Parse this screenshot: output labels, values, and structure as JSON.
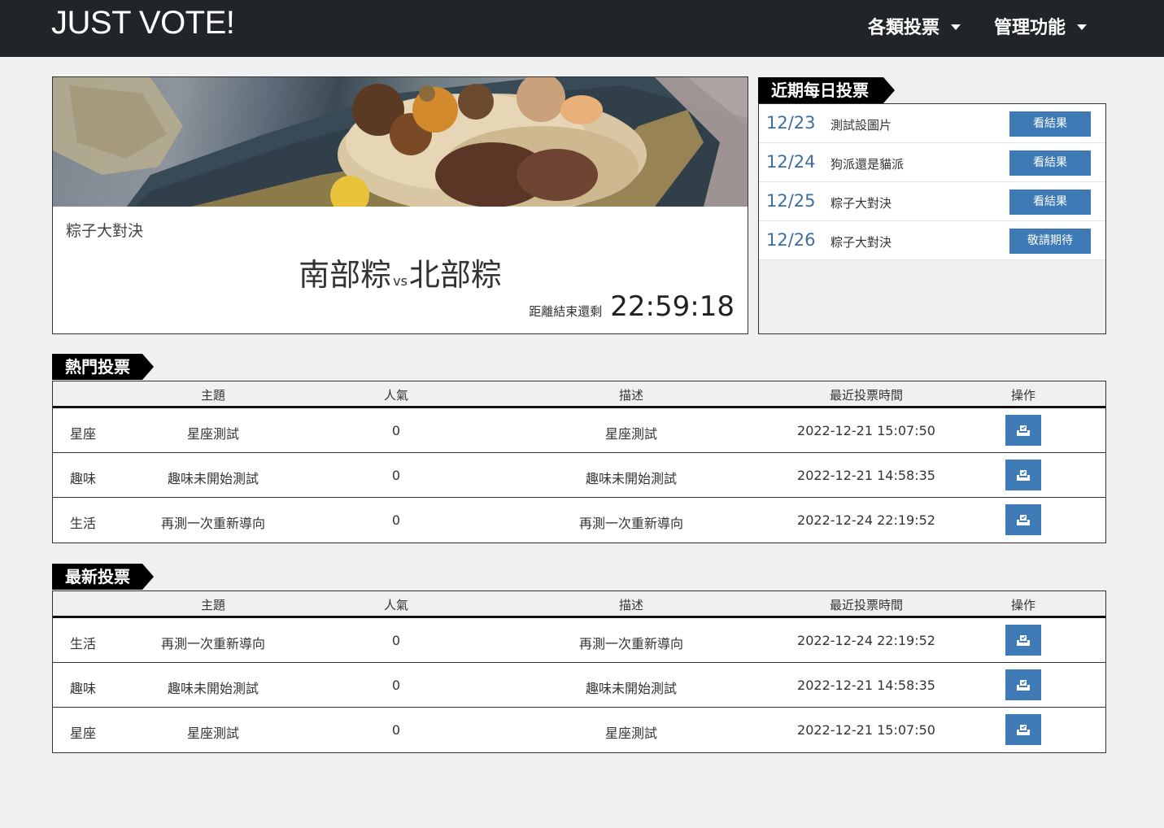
{
  "navbar": {
    "brand": "JUST VOTE!",
    "menus": [
      {
        "label": "各類投票"
      },
      {
        "label": "管理功能"
      }
    ]
  },
  "feature": {
    "title": "粽子大對決",
    "option_a": "南部粽",
    "vs": "vs",
    "option_b": "北部粽",
    "countdown_label": "距離結束還剩",
    "countdown_time": "22:59:18"
  },
  "daily": {
    "heading": "近期每日投票",
    "items": [
      {
        "date": "12/23",
        "topic": "測試設圖片",
        "button": "看結果"
      },
      {
        "date": "12/24",
        "topic": "狗派還是貓派",
        "button": "看結果"
      },
      {
        "date": "12/25",
        "topic": "粽子大對決",
        "button": "看結果"
      },
      {
        "date": "12/26",
        "topic": "粽子大對決",
        "button": "敬請期待"
      }
    ]
  },
  "table_headers": [
    "主題",
    "人氣",
    "描述",
    "最近投票時間",
    "操作"
  ],
  "hot": {
    "heading": "熱門投票",
    "rows": [
      {
        "category": "星座",
        "topic": "星座測試",
        "popularity": "0",
        "description": "星座測試",
        "last_vote": "2022-12-21 15:07:50"
      },
      {
        "category": "趣味",
        "topic": "趣味未開始測試",
        "popularity": "0",
        "description": "趣味未開始測試",
        "last_vote": "2022-12-21 14:58:35"
      },
      {
        "category": "生活",
        "topic": "再測一次重新導向",
        "popularity": "0",
        "description": "再測一次重新導向",
        "last_vote": "2022-12-24 22:19:52"
      }
    ]
  },
  "latest": {
    "heading": "最新投票",
    "rows": [
      {
        "category": "生活",
        "topic": "再測一次重新導向",
        "popularity": "0",
        "description": "再測一次重新導向",
        "last_vote": "2022-12-24 22:19:52"
      },
      {
        "category": "趣味",
        "topic": "趣味未開始測試",
        "popularity": "0",
        "description": "趣味未開始測試",
        "last_vote": "2022-12-21 14:58:35"
      },
      {
        "category": "星座",
        "topic": "星座測試",
        "popularity": "0",
        "description": "星座測試",
        "last_vote": "2022-12-21 15:07:50"
      }
    ]
  },
  "icons": {
    "vote_action": "vote-box-icon"
  },
  "colors": {
    "navbar": "#212529",
    "accent": "#3d7ab6",
    "date_text": "#3d6e9f",
    "background": "#f0f0f0"
  }
}
